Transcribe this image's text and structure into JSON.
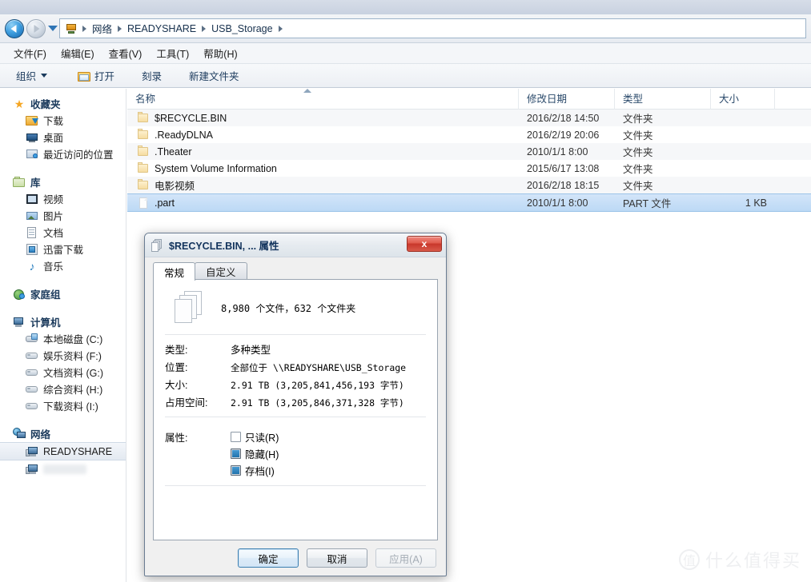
{
  "address_bar": {
    "back_label": "后退",
    "forward_label": "前进",
    "history_label": "最近的位置",
    "breadcrumbs": [
      "网络",
      "READYSHARE",
      "USB_Storage"
    ]
  },
  "menu": {
    "items": [
      "文件(F)",
      "编辑(E)",
      "查看(V)",
      "工具(T)",
      "帮助(H)"
    ]
  },
  "toolbar": {
    "organize_label": "组织",
    "open_label": "打开",
    "burn_label": "刻录",
    "new_folder_label": "新建文件夹"
  },
  "sidebar": {
    "groups": [
      {
        "label": "收藏夹",
        "icon": "star-icon",
        "items": [
          {
            "label": "下载",
            "icon": "folder-download-icon"
          },
          {
            "label": "桌面",
            "icon": "desktop-icon"
          },
          {
            "label": "最近访问的位置",
            "icon": "recent-places-icon"
          }
        ]
      },
      {
        "label": "库",
        "icon": "library-icon",
        "items": [
          {
            "label": "视频",
            "icon": "video-icon"
          },
          {
            "label": "图片",
            "icon": "picture-icon"
          },
          {
            "label": "文档",
            "icon": "document-icon"
          },
          {
            "label": "迅雷下载",
            "icon": "thunder-download-icon"
          },
          {
            "label": "音乐",
            "icon": "music-icon"
          }
        ]
      },
      {
        "label": "家庭组",
        "icon": "homegroup-icon",
        "items": []
      },
      {
        "label": "计算机",
        "icon": "computer-icon",
        "items": [
          {
            "label": "本地磁盘 (C:)",
            "icon": "system-drive-icon"
          },
          {
            "label": "娱乐资料 (F:)",
            "icon": "drive-icon"
          },
          {
            "label": "文档资料 (G:)",
            "icon": "drive-icon"
          },
          {
            "label": "综合资料 (H:)",
            "icon": "drive-icon"
          },
          {
            "label": "下载资料 (I:)",
            "icon": "drive-icon"
          }
        ]
      },
      {
        "label": "网络",
        "icon": "network-icon",
        "items": [
          {
            "label": "READYSHARE",
            "icon": "network-computer-icon",
            "selected": true
          },
          {
            "label": "",
            "icon": "network-computer-icon",
            "redacted": true
          }
        ]
      }
    ]
  },
  "file_list": {
    "columns": [
      "名称",
      "修改日期",
      "类型",
      "大小"
    ],
    "sort_column": "名称",
    "sort_direction": "asc",
    "rows": [
      {
        "name": "$RECYCLE.BIN",
        "date": "2016/2/18 14:50",
        "type": "文件夹",
        "size": "",
        "icon": "folder-icon",
        "selected": false
      },
      {
        "name": ".ReadyDLNA",
        "date": "2016/2/19 20:06",
        "type": "文件夹",
        "size": "",
        "icon": "folder-icon",
        "selected": false
      },
      {
        "name": ".Theater",
        "date": "2010/1/1 8:00",
        "type": "文件夹",
        "size": "",
        "icon": "folder-icon",
        "selected": false
      },
      {
        "name": "System Volume Information",
        "date": "2015/6/17 13:08",
        "type": "文件夹",
        "size": "",
        "icon": "folder-icon",
        "selected": false
      },
      {
        "name": "电影视频",
        "date": "2016/2/18 18:15",
        "type": "文件夹",
        "size": "",
        "icon": "folder-icon",
        "selected": false
      },
      {
        "name": ".part",
        "date": "2010/1/1 8:00",
        "type": "PART 文件",
        "size": "1 KB",
        "icon": "file-icon",
        "selected": true
      }
    ]
  },
  "dialog": {
    "title": "$RECYCLE.BIN, ... 属性",
    "close_label": "x",
    "tabs": [
      {
        "label": "常规",
        "active": true
      },
      {
        "label": "自定义",
        "active": false
      }
    ],
    "summary": "8,980 个文件，632 个文件夹",
    "properties": [
      {
        "label": "类型:",
        "value": "多种类型",
        "cjk": true
      },
      {
        "label": "位置:",
        "value": "全部位于 \\\\READYSHARE\\USB_Storage",
        "cjk": false
      },
      {
        "label": "大小:",
        "value": "2.91 TB (3,205,841,456,193 字节)",
        "cjk": false
      },
      {
        "label": "占用空间:",
        "value": "2.91 TB (3,205,846,371,328 字节)",
        "cjk": false
      }
    ],
    "attributes_label": "属性:",
    "attributes": [
      {
        "label": "只读(R)",
        "state": "unchecked"
      },
      {
        "label": "隐藏(H)",
        "state": "indeterminate"
      },
      {
        "label": "存档(I)",
        "state": "indeterminate"
      }
    ],
    "buttons": [
      {
        "label": "确定",
        "style": "default",
        "enabled": true
      },
      {
        "label": "取消",
        "style": "normal",
        "enabled": true
      },
      {
        "label": "应用(A)",
        "style": "normal",
        "enabled": false
      }
    ]
  },
  "watermark": {
    "logo": "值",
    "text": "什么值得买"
  }
}
